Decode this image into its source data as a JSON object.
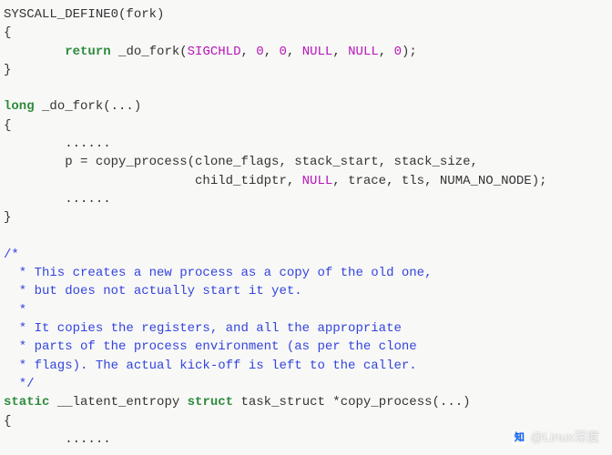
{
  "code": {
    "l1_a": "SYSCALL_DEFINE0(fork)",
    "l2": "{",
    "l3_kw": "return",
    "l3_b": " _do_fork(",
    "l3_c": "SIGCHLD",
    "l3_d": ", ",
    "l3_e": "0",
    "l3_f": ", ",
    "l3_g": "0",
    "l3_h": ", ",
    "l3_i": "NULL",
    "l3_j": ", ",
    "l3_k": "NULL",
    "l3_l": ", ",
    "l3_m": "0",
    "l3_n": ");",
    "l4": "}",
    "l5": "",
    "l6_kw": "long",
    "l6_b": " _do_fork(...)",
    "l7": "{",
    "l8": "        ......",
    "l9": "        p = copy_process(clone_flags, stack_start, stack_size,",
    "l10_a": "                         child_tidptr, ",
    "l10_b": "NULL",
    "l10_c": ", trace, tls, NUMA_NO_NODE);",
    "l11": "        ......",
    "l12": "}",
    "l13": "",
    "c1": "/*",
    "c2": "  * This creates a new process as a copy of the old one,",
    "c3": "  * but does not actually start it yet.",
    "c4": "  *",
    "c5": "  * It copies the registers, and all the appropriate",
    "c6": "  * parts of the process environment (as per the clone",
    "c7": "  * flags). The actual kick-off is left to the caller.",
    "c8": "  */",
    "l22_a": "static",
    "l22_b": " __latent_entropy ",
    "l22_c": "struct",
    "l22_d": " task_struct *copy_process(...)",
    "l23": "{",
    "l24": "        ......"
  },
  "watermark": "@Linux深度"
}
